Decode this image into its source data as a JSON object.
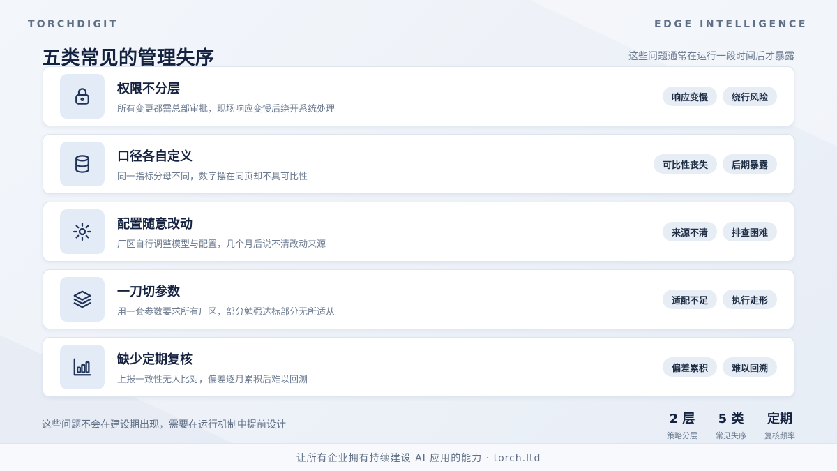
{
  "header": {
    "brand": "TORCHDIGIT",
    "tagline": "EDGE INTELLIGENCE"
  },
  "main": {
    "title": "五类常见的管理失序",
    "subtitle": "这些问题通常在运行一段时间后才暴露",
    "items": [
      {
        "icon": "lock-icon",
        "title": "权限不分层",
        "desc": "所有变更都需总部审批，现场响应变慢后绕开系统处理",
        "tags": [
          "响应变慢",
          "绕行风险"
        ]
      },
      {
        "icon": "database-icon",
        "title": "口径各自定义",
        "desc": "同一指标分母不同，数字摆在同页却不具可比性",
        "tags": [
          "可比性丧失",
          "后期暴露"
        ]
      },
      {
        "icon": "sun-icon",
        "title": "配置随意改动",
        "desc": "厂区自行调整模型与配置，几个月后说不清改动来源",
        "tags": [
          "来源不清",
          "排查困难"
        ]
      },
      {
        "icon": "layers-icon",
        "title": "一刀切参数",
        "desc": "用一套参数要求所有厂区，部分勉强达标部分无所适从",
        "tags": [
          "适配不足",
          "执行走形"
        ]
      },
      {
        "icon": "bar-chart-icon",
        "title": "缺少定期复核",
        "desc": "上报一致性无人比对，偏差逐月累积后难以回溯",
        "tags": [
          "偏差累积",
          "难以回溯"
        ]
      }
    ]
  },
  "footer": {
    "note": "这些问题不会在建设期出现，需要在运行机制中提前设计",
    "stats": [
      {
        "value": "2 层",
        "label": "策略分层"
      },
      {
        "value": "5 类",
        "label": "常见失序"
      },
      {
        "value": "定期",
        "label": "复核频率"
      }
    ],
    "bottom_text": "让所有企业拥有持续建设 AI 应用的能力 · torch.ltd"
  },
  "colors": {
    "icon_stroke": "#1f3257",
    "icon_bg": "#e3ebf6",
    "title": "#142240",
    "tag_bg": "#e7edf5"
  }
}
